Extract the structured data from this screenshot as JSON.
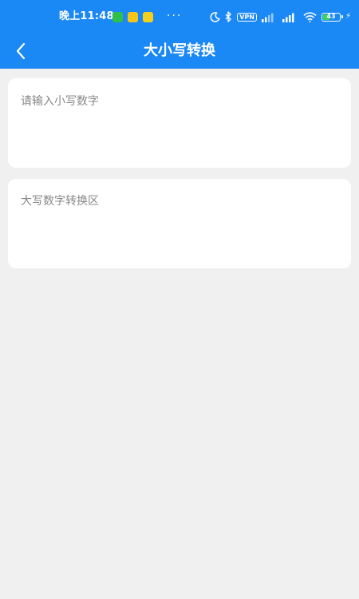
{
  "status_bar": {
    "time": "晚上11:48",
    "more": "···",
    "vpn": "VPN",
    "battery_level": "43",
    "battery_percent": 43
  },
  "nav": {
    "title": "大小写转换"
  },
  "input_card": {
    "placeholder": "请输入小写数字",
    "value": ""
  },
  "output_card": {
    "placeholder": "大写数字转换区"
  },
  "colors": {
    "primary": "#1a88f5",
    "background": "#f0f0f0",
    "card": "#ffffff",
    "placeholder_text": "#888888"
  }
}
